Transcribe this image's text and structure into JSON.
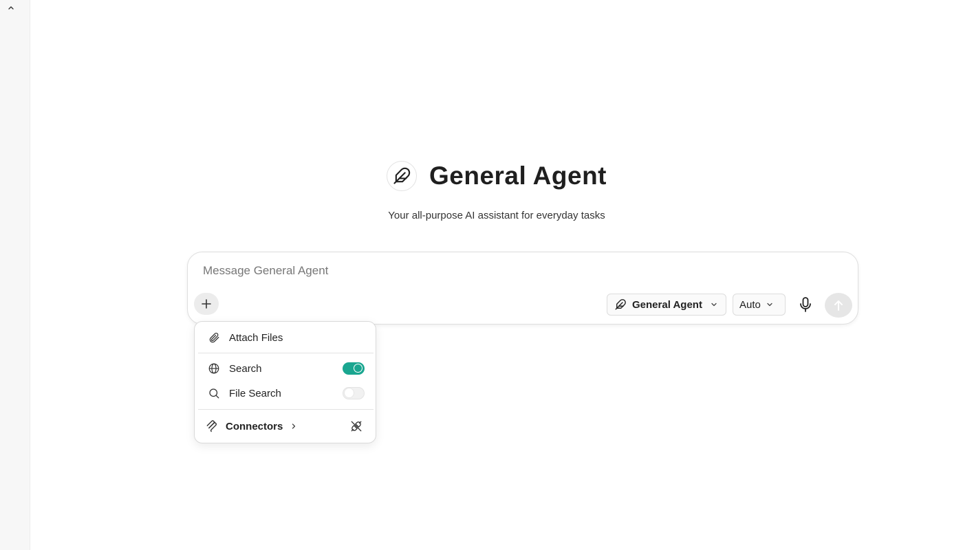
{
  "sidebar": {
    "collapse_icon": "chevron-up-icon"
  },
  "hero": {
    "logo_icon": "feather-icon",
    "title": "General Agent",
    "subtitle": "Your all-purpose AI assistant for everyday tasks"
  },
  "composer": {
    "placeholder": "Message General Agent",
    "value": "",
    "plus_icon": "plus-icon",
    "agent_select": {
      "icon": "feather-icon",
      "label": "General Agent"
    },
    "mode_select": {
      "label": "Auto"
    },
    "mic_icon": "microphone-icon",
    "send_icon": "arrow-up-icon"
  },
  "tools_menu": {
    "attach": {
      "icon": "paperclip-icon",
      "label": "Attach Files"
    },
    "search": {
      "icon": "globe-icon",
      "label": "Search",
      "enabled": true
    },
    "file_search": {
      "icon": "magnifier-icon",
      "label": "File Search",
      "enabled": false
    },
    "connectors": {
      "icon": "connectors-icon",
      "label": "Connectors",
      "end_icon": "unplug-icon"
    }
  },
  "colors": {
    "accent": "#1aa690",
    "toggle_off": "#f1f1f1"
  }
}
